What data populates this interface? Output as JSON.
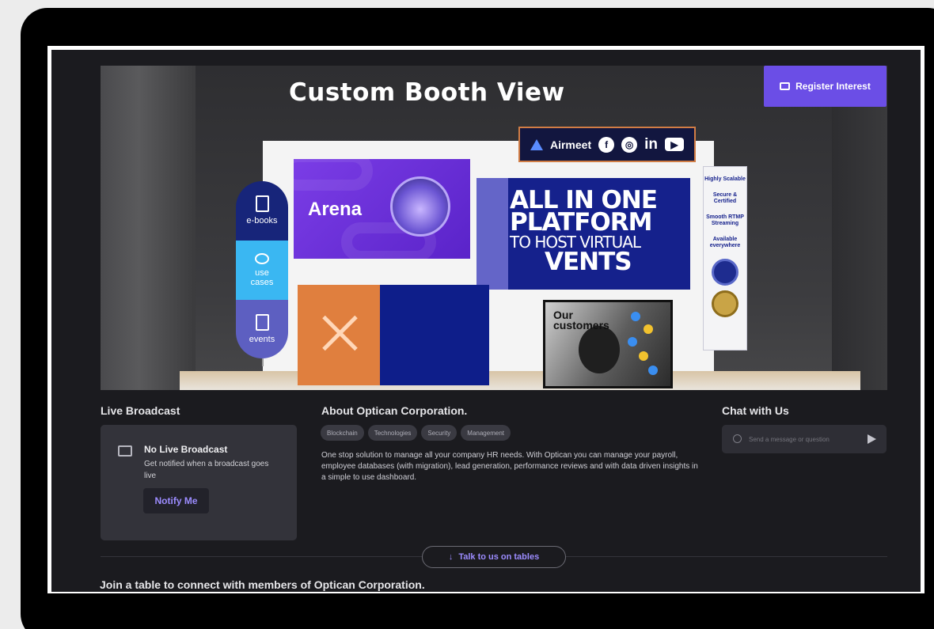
{
  "booth": {
    "title": "Custom Booth View",
    "register_label": "Register Interest",
    "brand_bar": {
      "name": "Airmeet",
      "icons": [
        "facebook-icon",
        "instagram-icon",
        "linkedin-icon",
        "youtube-icon"
      ]
    },
    "resource_pill": [
      {
        "label": "e-books",
        "icon": "book-icon"
      },
      {
        "label": "use cases",
        "icon": "people-icon"
      },
      {
        "label": "events",
        "icon": "calendar-icon"
      }
    ],
    "arena_banner": {
      "name": "Arena"
    },
    "platform_banner": {
      "line1": "ALL IN ONE",
      "line2": "PLATFORM",
      "line3": "TO HOST VIRTUAL",
      "line4": "VENTS"
    },
    "customers_screen": {
      "line1": "Our",
      "line2": "customers"
    },
    "side_banner": [
      "Highly Scalable",
      "Secure & Certified",
      "Smooth RTMP Streaming",
      "Available everywhere"
    ]
  },
  "live_broadcast": {
    "title": "Live Broadcast",
    "heading": "No Live Broadcast",
    "description": "Get notified when a broadcast goes live",
    "notify_label": "Notify Me"
  },
  "about": {
    "title": "About Optican Corporation.",
    "tags": [
      "Blockchain",
      "Technologies",
      "Security",
      "Management"
    ],
    "description": "One stop solution to manage all your company HR needs. With Optican you can manage your payroll, employee databases (with migration), lead generation, performance reviews and with data driven insights in a simple to use dashboard."
  },
  "chat": {
    "title": "Chat with Us",
    "placeholder": "Send a message or question"
  },
  "tables": {
    "talk_label": "Talk to us on tables",
    "join_text": "Join a table to connect with members of Optican Corporation."
  },
  "colors": {
    "accent": "#6b4ee6",
    "link": "#9c8cff",
    "background": "#1b1b1f"
  }
}
